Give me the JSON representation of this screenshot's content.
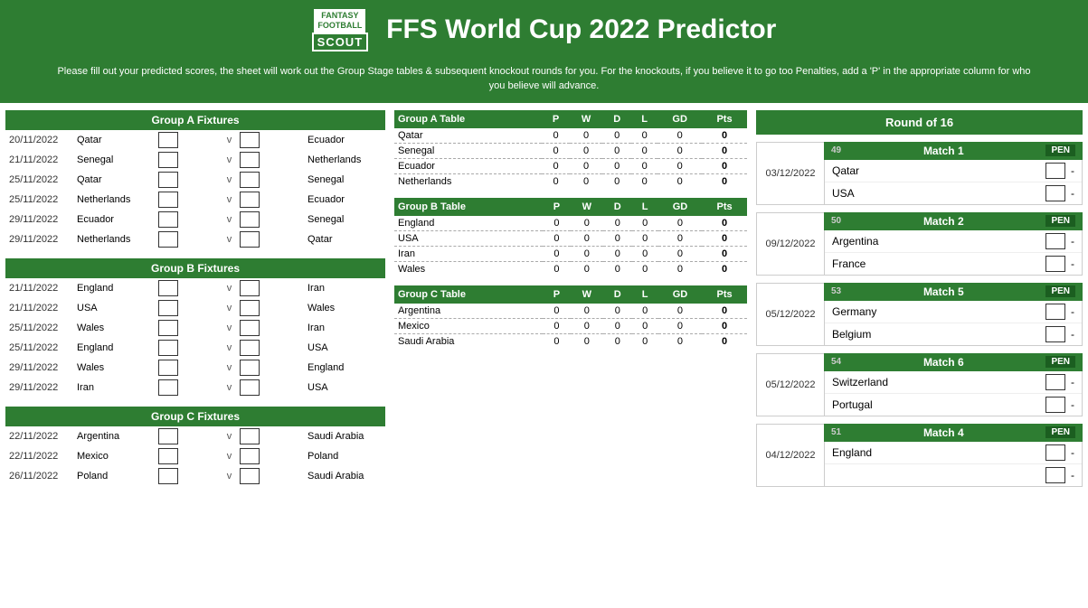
{
  "header": {
    "title": "FFS World Cup 2022 Predictor",
    "subtitle": "Please fill out your predicted scores, the sheet will work out the Group Stage tables & subsequent knockout rounds for you. For the knockouts, if you believe it to go too Penalties, add a 'P' in the appropriate column for who you believe will advance.",
    "logo_line1": "FANTASY\nFOOTBALL",
    "logo_line2": "SCOUT"
  },
  "groupA": {
    "header": "Group A Fixtures",
    "fixtures": [
      {
        "date": "20/11/2022",
        "home": "Qatar",
        "away": "Ecuador"
      },
      {
        "date": "21/11/2022",
        "home": "Senegal",
        "away": "Netherlands"
      },
      {
        "date": "25/11/2022",
        "home": "Qatar",
        "away": "Senegal"
      },
      {
        "date": "25/11/2022",
        "home": "Netherlands",
        "away": "Ecuador"
      },
      {
        "date": "29/11/2022",
        "home": "Ecuador",
        "away": "Senegal"
      },
      {
        "date": "29/11/2022",
        "home": "Netherlands",
        "away": "Qatar"
      }
    ],
    "tableHeader": "Group A Table",
    "columns": [
      "P",
      "W",
      "D",
      "L",
      "GD",
      "Pts"
    ],
    "teams": [
      {
        "name": "Qatar",
        "p": 0,
        "w": 0,
        "d": 0,
        "l": 0,
        "gd": 0,
        "pts": 0
      },
      {
        "name": "Senegal",
        "p": 0,
        "w": 0,
        "d": 0,
        "l": 0,
        "gd": 0,
        "pts": 0
      },
      {
        "name": "Ecuador",
        "p": 0,
        "w": 0,
        "d": 0,
        "l": 0,
        "gd": 0,
        "pts": 0
      },
      {
        "name": "Netherlands",
        "p": 0,
        "w": 0,
        "d": 0,
        "l": 0,
        "gd": 0,
        "pts": 0
      }
    ]
  },
  "groupB": {
    "header": "Group B Fixtures",
    "fixtures": [
      {
        "date": "21/11/2022",
        "home": "England",
        "away": "Iran"
      },
      {
        "date": "21/11/2022",
        "home": "USA",
        "away": "Wales"
      },
      {
        "date": "25/11/2022",
        "home": "Wales",
        "away": "Iran"
      },
      {
        "date": "25/11/2022",
        "home": "England",
        "away": "USA"
      },
      {
        "date": "29/11/2022",
        "home": "Wales",
        "away": "England"
      },
      {
        "date": "29/11/2022",
        "home": "Iran",
        "away": "USA"
      }
    ],
    "tableHeader": "Group B Table",
    "columns": [
      "P",
      "W",
      "D",
      "L",
      "GD",
      "Pts"
    ],
    "teams": [
      {
        "name": "England",
        "p": 0,
        "w": 0,
        "d": 0,
        "l": 0,
        "gd": 0,
        "pts": 0
      },
      {
        "name": "USA",
        "p": 0,
        "w": 0,
        "d": 0,
        "l": 0,
        "gd": 0,
        "pts": 0
      },
      {
        "name": "Iran",
        "p": 0,
        "w": 0,
        "d": 0,
        "l": 0,
        "gd": 0,
        "pts": 0
      },
      {
        "name": "Wales",
        "p": 0,
        "w": 0,
        "d": 0,
        "l": 0,
        "gd": 0,
        "pts": 0
      }
    ]
  },
  "groupC": {
    "header": "Group C Fixtures",
    "fixtures": [
      {
        "date": "22/11/2022",
        "home": "Argentina",
        "away": "Saudi Arabia"
      },
      {
        "date": "22/11/2022",
        "home": "Mexico",
        "away": "Poland"
      },
      {
        "date": "26/11/2022",
        "home": "Poland",
        "away": "Saudi Arabia"
      }
    ],
    "tableHeader": "Group C Table",
    "columns": [
      "P",
      "W",
      "D",
      "L",
      "GD",
      "Pts"
    ],
    "teams": [
      {
        "name": "Argentina",
        "p": 0,
        "w": 0,
        "d": 0,
        "l": 0,
        "gd": 0,
        "pts": 0
      },
      {
        "name": "Mexico",
        "p": 0,
        "w": 0,
        "d": 0,
        "l": 0,
        "gd": 0,
        "pts": 0
      },
      {
        "name": "Saudi Arabia",
        "p": 0,
        "w": 0,
        "d": 0,
        "l": 0,
        "gd": 0,
        "pts": 0
      }
    ]
  },
  "round16": {
    "header": "Round of 16",
    "matches": [
      {
        "id": "match1",
        "label": "Match 1",
        "seed": "49",
        "date": "03/12/2022",
        "team1": "Qatar",
        "team2": "USA",
        "pen_label": "PEN"
      },
      {
        "id": "match2",
        "label": "Match 2",
        "seed": "50",
        "date": "09/12/2022",
        "team1": "Argentina",
        "team2": "France",
        "pen_label": "PEN"
      },
      {
        "id": "match5",
        "label": "Match 5",
        "seed": "53",
        "date": "05/12/2022",
        "team1": "Germany",
        "team2": "Belgium",
        "pen_label": "PEN"
      },
      {
        "id": "match6",
        "label": "Match 6",
        "seed": "54",
        "date": "05/12/2022",
        "team1": "Switzerland",
        "team2": "Portugal",
        "pen_label": "PEN"
      },
      {
        "id": "match4",
        "label": "Match 4",
        "seed": "51",
        "date": "04/12/2022",
        "team1": "England",
        "team2": "",
        "pen_label": "PEN"
      }
    ]
  }
}
